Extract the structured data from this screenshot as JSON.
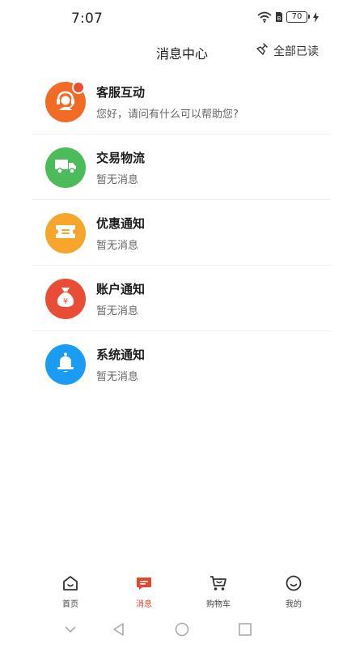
{
  "status_bar": {
    "time": "7:07",
    "battery": "70",
    "icons": [
      "wifi-icon",
      "sim-icon",
      "battery-icon",
      "charging-icon"
    ]
  },
  "header": {
    "title": "消息中心",
    "mark_all_label": "全部已读",
    "mark_all_icon": "broom-icon"
  },
  "colors": {
    "accent": "#e8452a",
    "service": "#f26b25",
    "logistics": "#4cbb5a",
    "discount": "#f7a52b",
    "account": "#ea4d35",
    "system": "#1b9cf3"
  },
  "messages": [
    {
      "title": "客服互动",
      "subtitle": "您好，请问有什么可以帮助您?",
      "icon": "customer-service-icon",
      "unread": true
    },
    {
      "title": "交易物流",
      "subtitle": "暂无消息",
      "icon": "truck-icon",
      "unread": false
    },
    {
      "title": "优惠通知",
      "subtitle": "暂无消息",
      "icon": "ticket-icon",
      "unread": false
    },
    {
      "title": "账户通知",
      "subtitle": "暂无消息",
      "icon": "money-bag-icon",
      "unread": false
    },
    {
      "title": "系统通知",
      "subtitle": "暂无消息",
      "icon": "bell-icon",
      "unread": false
    }
  ],
  "tabs": [
    {
      "label": "首页",
      "icon": "home-icon",
      "active": false
    },
    {
      "label": "消息",
      "icon": "message-icon",
      "active": true
    },
    {
      "label": "购物车",
      "icon": "cart-icon",
      "active": false
    },
    {
      "label": "我的",
      "icon": "profile-icon",
      "active": false
    }
  ],
  "nav": [
    "collapse-icon",
    "back-icon",
    "home-circle-icon",
    "recents-icon"
  ]
}
